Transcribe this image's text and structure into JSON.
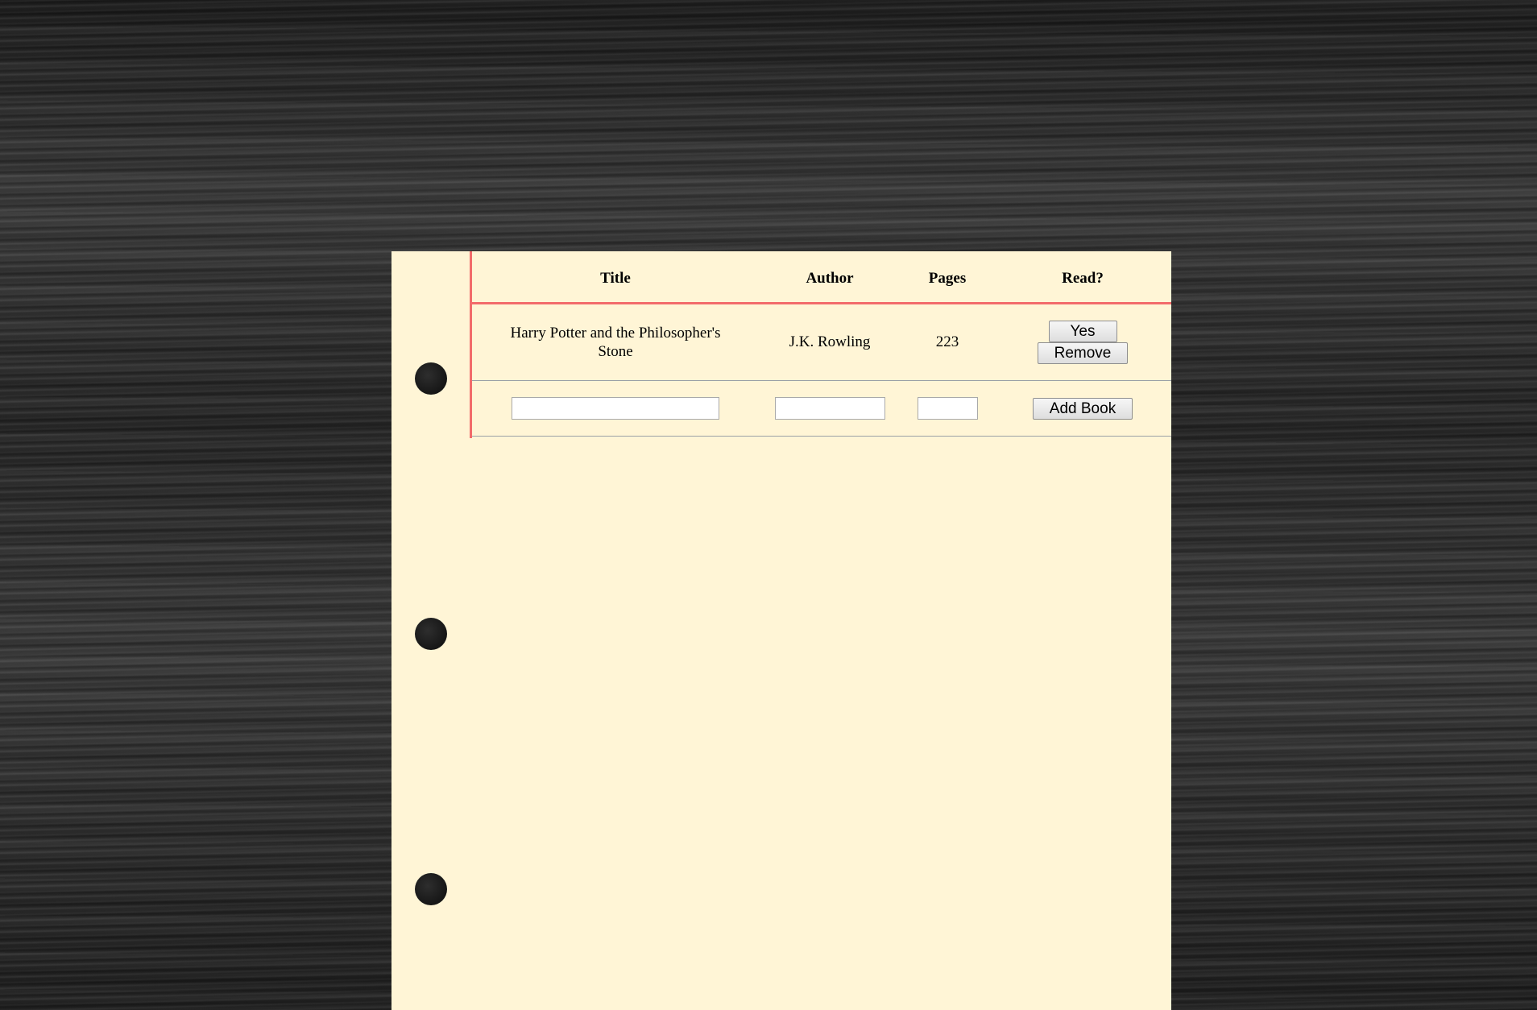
{
  "table": {
    "headers": {
      "title": "Title",
      "author": "Author",
      "pages": "Pages",
      "read": "Read?"
    },
    "books": [
      {
        "title": "Harry Potter and the Philosopher's Stone",
        "author": "J.K. Rowling",
        "pages": "223",
        "read_label": "Yes",
        "remove_label": "Remove"
      }
    ]
  },
  "form": {
    "title_value": "",
    "author_value": "",
    "pages_value": "",
    "add_label": "Add Book"
  },
  "colors": {
    "paper": "#fff5d6",
    "margin_line": "#f26b6b",
    "rule_line": "#9aa0a6",
    "background": "#2c2c2c"
  }
}
